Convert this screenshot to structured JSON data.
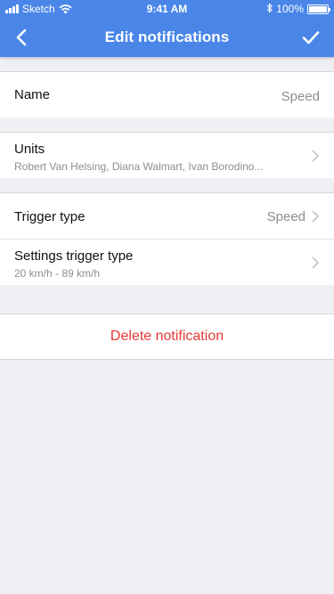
{
  "status_bar": {
    "carrier": "Sketch",
    "time": "9:41 AM",
    "battery_percent": "100%",
    "battery_level": 1.0,
    "icons": [
      "signal-icon",
      "wifi-icon",
      "bluetooth-icon",
      "battery-icon"
    ]
  },
  "nav": {
    "title": "Edit notifications",
    "back_icon": "chevron-left-icon",
    "confirm_icon": "checkmark-icon"
  },
  "rows": {
    "name": {
      "label": "Name",
      "value": "Speed"
    },
    "units": {
      "label": "Units",
      "subtitle": "Robert Van Helsing, Diana Walmart, Ivan Borodino..."
    },
    "trigger_type": {
      "label": "Trigger type",
      "value": "Speed"
    },
    "settings_trigger_type": {
      "label": "Settings trigger type",
      "subtitle": "20 km/h - 89 km/h"
    }
  },
  "delete": {
    "label": "Delete notification"
  },
  "colors": {
    "header": "#4a86e8",
    "background": "#efeff4",
    "danger": "#e53935",
    "secondary_text": "#8e8e93"
  }
}
